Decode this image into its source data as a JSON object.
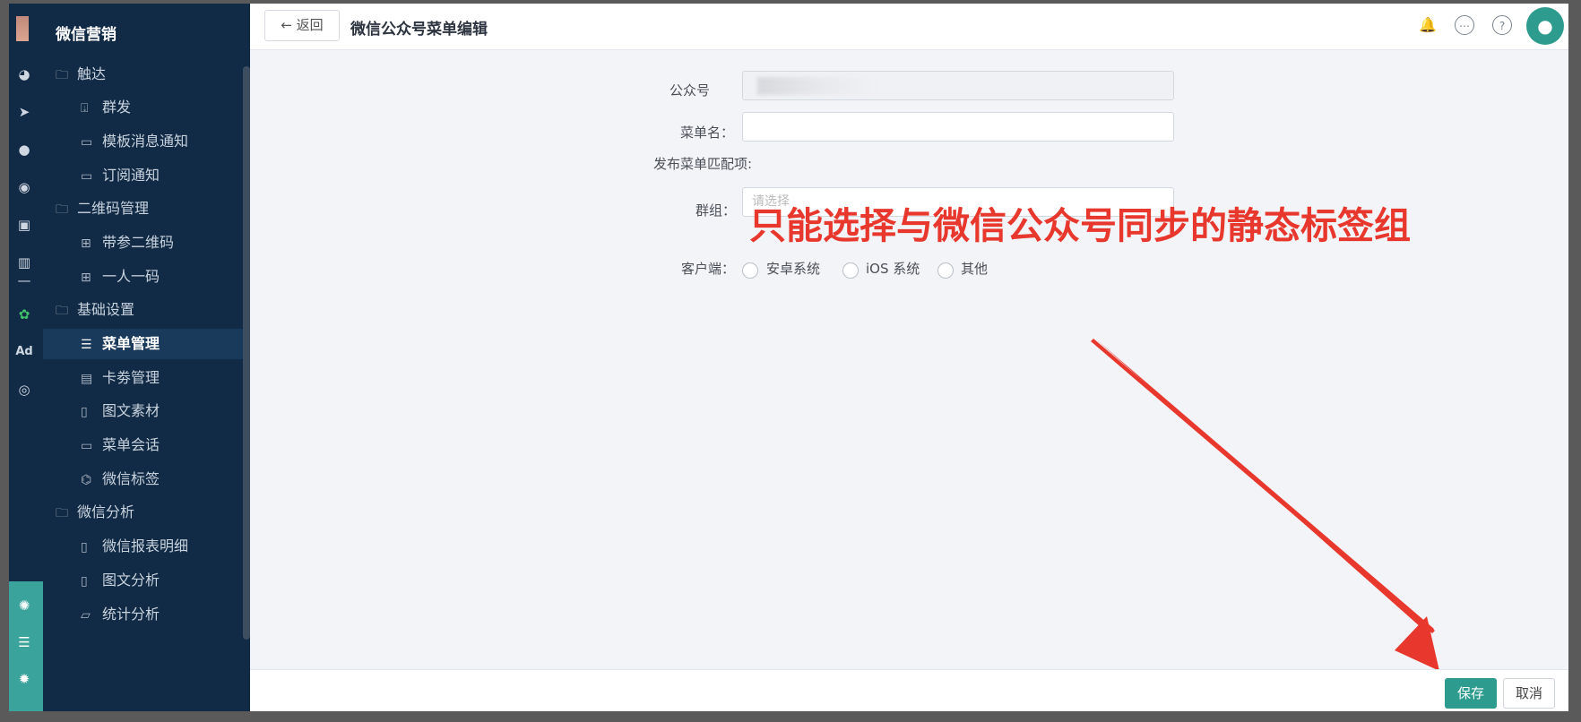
{
  "app": {
    "title": "微信营销"
  },
  "header": {
    "back_label": "← 返回",
    "page_title": "微信公众号菜单编辑",
    "icons": [
      "bell-icon",
      "message-icon",
      "help-icon",
      "user-avatar-icon"
    ]
  },
  "sidebar": {
    "items": [
      {
        "label": "触达",
        "type": "group",
        "icon": "folder-icon"
      },
      {
        "label": "群发",
        "type": "sub",
        "icon": "send-box-icon"
      },
      {
        "label": "模板消息通知",
        "type": "sub",
        "icon": "template-icon"
      },
      {
        "label": "订阅通知",
        "type": "sub",
        "icon": "subscribe-icon"
      },
      {
        "label": "二维码管理",
        "type": "group",
        "icon": "folder-icon"
      },
      {
        "label": "带参二维码",
        "type": "sub",
        "icon": "qrcode-icon"
      },
      {
        "label": "一人一码",
        "type": "sub",
        "icon": "qrcode-icon"
      },
      {
        "label": "基础设置",
        "type": "group",
        "icon": "folder-icon"
      },
      {
        "label": "菜单管理",
        "type": "sub",
        "icon": "list-icon",
        "active": true
      },
      {
        "label": "卡劵管理",
        "type": "sub",
        "icon": "coupon-icon"
      },
      {
        "label": "图文素材",
        "type": "sub",
        "icon": "document-icon"
      },
      {
        "label": "菜单会话",
        "type": "sub",
        "icon": "chat-icon"
      },
      {
        "label": "微信标签",
        "type": "sub",
        "icon": "tag-icon"
      },
      {
        "label": "微信分析",
        "type": "group",
        "icon": "folder-icon"
      },
      {
        "label": "微信报表明细",
        "type": "sub",
        "icon": "report-icon"
      },
      {
        "label": "图文分析",
        "type": "sub",
        "icon": "report-icon"
      },
      {
        "label": "统计分析",
        "type": "sub",
        "icon": "stats-icon"
      }
    ]
  },
  "form": {
    "account_label": "公众号",
    "menu_name_label": "菜单名：",
    "menu_name_value": "",
    "match_label": "发布菜单匹配项:",
    "group_label": "群组：",
    "group_placeholder": "请选择",
    "client_label": "客户端：",
    "client_options": [
      "安卓系统",
      "iOS 系统",
      "其他"
    ]
  },
  "annotation": {
    "text": "只能选择与微信公众号同步的静态标签组",
    "color": "#e8382d"
  },
  "footer": {
    "save_label": "保存",
    "cancel_label": "取消"
  },
  "colors": {
    "sidebar_bg": "#112a45",
    "accent": "#2e9b8f",
    "annotation_red": "#e8382d"
  }
}
